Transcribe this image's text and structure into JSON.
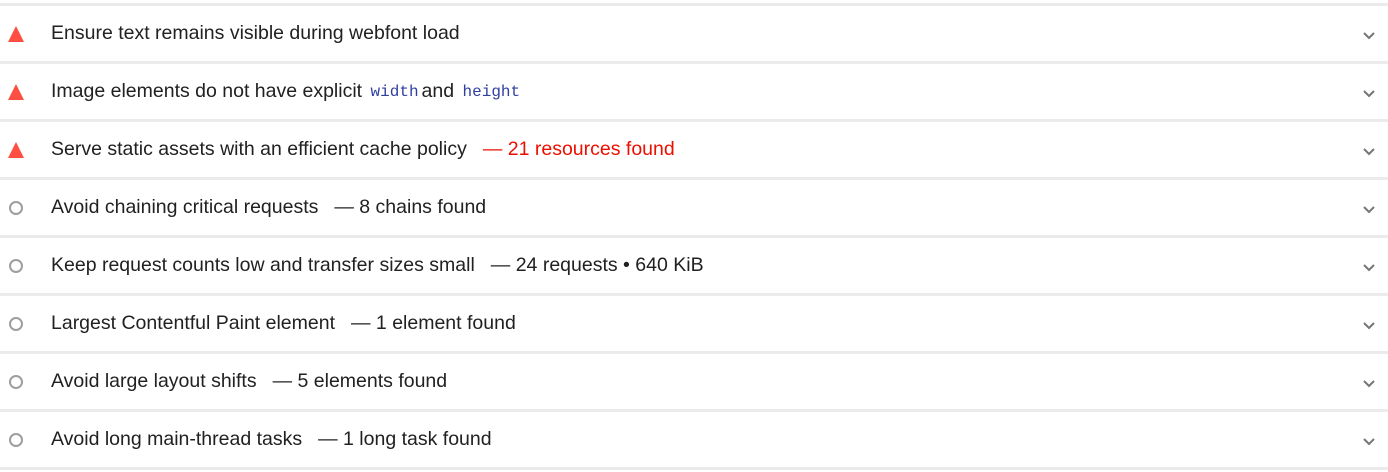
{
  "colors": {
    "fail": "#ff4e42",
    "fail_text": "#eb0f00",
    "neutral": "#9e9e9e",
    "code": "#303f9f"
  },
  "audits": [
    {
      "status": "fail",
      "status_icon": "warning-triangle-icon",
      "title": "Ensure text remains visible during webfont load",
      "display": ""
    },
    {
      "status": "fail",
      "status_icon": "warning-triangle-icon",
      "title_pre": "Image elements do not have explicit",
      "code1": "width",
      "title_mid": "and",
      "code2": "height",
      "display": ""
    },
    {
      "status": "fail",
      "status_icon": "warning-triangle-icon",
      "title": "Serve static assets with an efficient cache policy",
      "display": "— 21 resources found"
    },
    {
      "status": "info",
      "status_icon": "circle-icon",
      "title": "Avoid chaining critical requests",
      "display": "— 8 chains found"
    },
    {
      "status": "info",
      "status_icon": "circle-icon",
      "title": "Keep request counts low and transfer sizes small",
      "display": "— 24 requests • 640 KiB"
    },
    {
      "status": "info",
      "status_icon": "circle-icon",
      "title": "Largest Contentful Paint element",
      "display": "— 1 element found"
    },
    {
      "status": "info",
      "status_icon": "circle-icon",
      "title": "Avoid large layout shifts",
      "display": "— 5 elements found"
    },
    {
      "status": "info",
      "status_icon": "circle-icon",
      "title": "Avoid long main-thread tasks",
      "display": "— 1 long task found"
    }
  ]
}
